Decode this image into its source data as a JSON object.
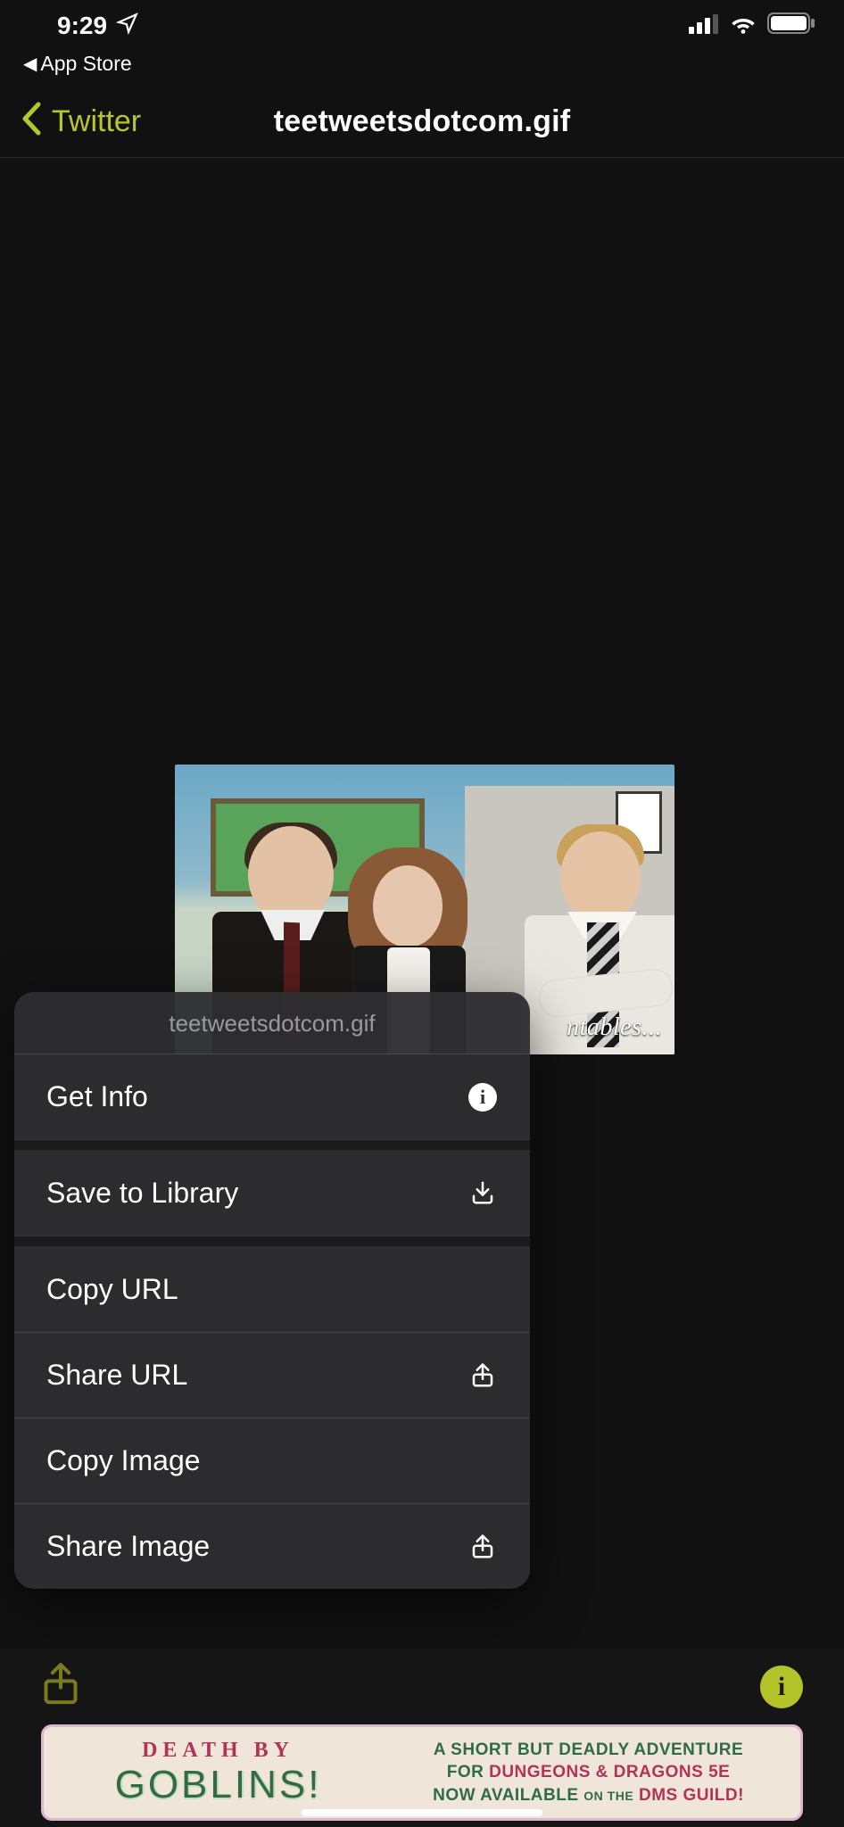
{
  "status": {
    "time": "9:29",
    "app_back": "App Store"
  },
  "nav": {
    "back_label": "Twitter",
    "title": "teetweetsdotcom.gif"
  },
  "gif": {
    "caption_fragment": "ntables..."
  },
  "menu": {
    "title": "teetweetsdotcom.gif",
    "get_info": "Get Info",
    "save_library": "Save to Library",
    "copy_url": "Copy URL",
    "share_url": "Share URL",
    "copy_image": "Copy Image",
    "share_image": "Share Image"
  },
  "ad": {
    "top": "DEATH  BY",
    "big": "GOBLINS!",
    "line1_a": "A SHORT BUT DEADLY ADVENTURE",
    "line2_pre": "FOR ",
    "line2_accent": "DUNGEONS & DRAGONS 5E",
    "line3_pre": "NOW AVAILABLE ",
    "line3_small": "ON THE",
    "line3_accent": " DMS GUILD!"
  }
}
